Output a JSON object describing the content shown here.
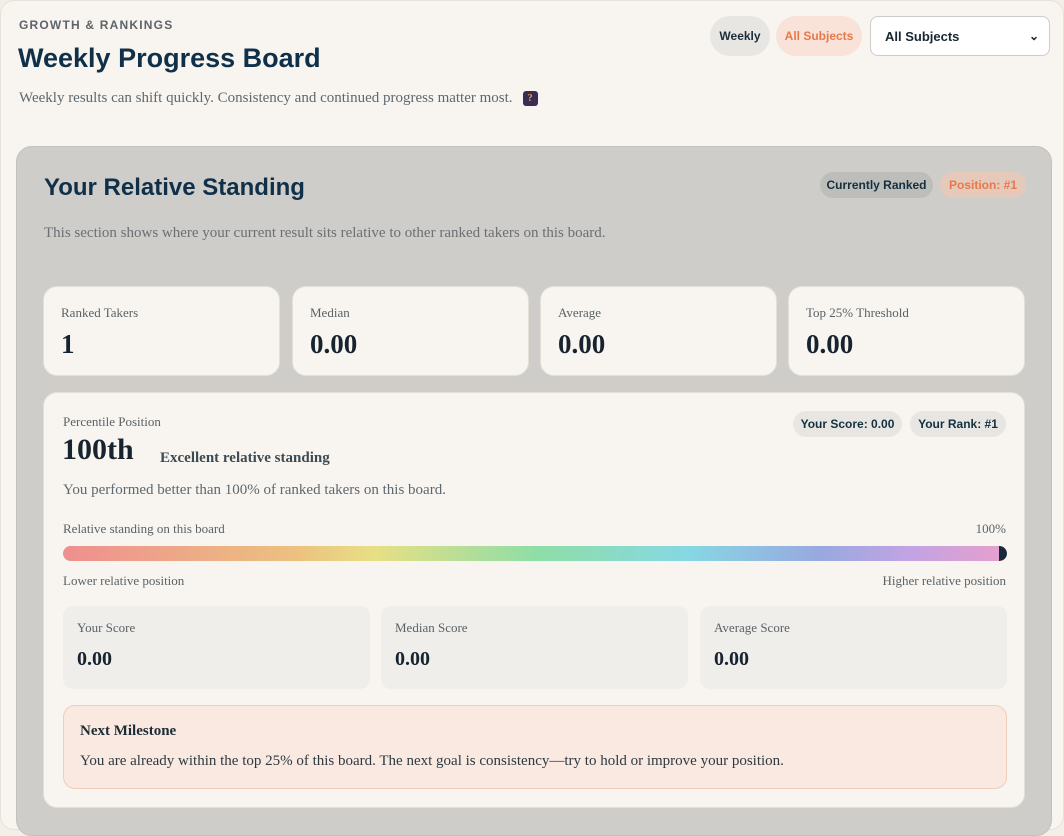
{
  "header": {
    "eyebrow": "GROWTH & RANKINGS",
    "title": "Weekly Progress Board",
    "subtitle": "Weekly results can shift quickly. Consistency and continued progress matter most.",
    "info_icon": "speech-bubble-question-icon"
  },
  "filters": {
    "period_label": "Weekly",
    "subject_pill_label": "All Subjects",
    "subject_select_value": "All Subjects"
  },
  "standing": {
    "title": "Your Relative Standing",
    "badge_status": "Currently Ranked",
    "badge_position": "Position: #1",
    "description": "This section shows where your current result sits relative to other ranked takers on this board.",
    "stats": [
      {
        "label": "Ranked Takers",
        "value": "1"
      },
      {
        "label": "Median",
        "value": "0.00"
      },
      {
        "label": "Average",
        "value": "0.00"
      },
      {
        "label": "Top 25% Threshold",
        "value": "0.00"
      }
    ],
    "percentile": {
      "label": "Percentile Position",
      "value": "100th",
      "descriptor": "Excellent relative standing",
      "sentence": "You performed better than 100% of ranked takers on this board.",
      "your_score_badge": "Your Score: 0.00",
      "your_rank_badge": "Your Rank: #1",
      "bar_caption": "Relative standing on this board",
      "bar_value_label": "100%",
      "bar_fraction": 1.0,
      "bar_low_label": "Lower relative position",
      "bar_high_label": "Higher relative position"
    },
    "scores": [
      {
        "label": "Your Score",
        "value": "0.00"
      },
      {
        "label": "Median Score",
        "value": "0.00"
      },
      {
        "label": "Average Score",
        "value": "0.00"
      }
    ],
    "milestone": {
      "title": "Next Milestone",
      "text": "You are already within the top 25% of this board. The next goal is consistency—try to hold or improve your position."
    }
  }
}
